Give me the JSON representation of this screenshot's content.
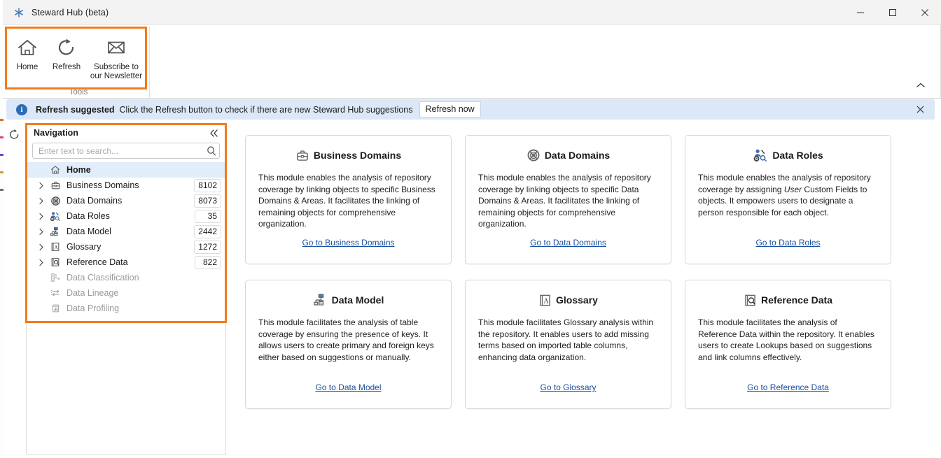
{
  "window": {
    "title": "Steward Hub (beta)",
    "app_icon": "asterisk-icon",
    "minimize_label": "—",
    "maximize_label": "□",
    "close_label": "✕"
  },
  "ribbon": {
    "group_title": "Tools",
    "collapse_label": "˄",
    "buttons": [
      {
        "id": "home",
        "label": "Home",
        "icon": "home-icon"
      },
      {
        "id": "refresh",
        "label": "Refresh",
        "icon": "refresh-icon"
      },
      {
        "id": "subscribe",
        "label": "Subscribe to our Newsletter",
        "icon": "envelope-icon"
      }
    ]
  },
  "notification": {
    "icon": "info-icon",
    "icon_glyph": "i",
    "title": "Refresh suggested",
    "message": "Click the Refresh button to check if there are new Steward Hub suggestions",
    "action_label": "Refresh now",
    "close_label": "✕",
    "background": "#dce8f7",
    "accent": "#2b6cb4"
  },
  "left_strip": {
    "refresh_icon": "refresh-icon"
  },
  "navigation": {
    "title": "Navigation",
    "collapse_label": "«",
    "search": {
      "placeholder": "Enter text to search...",
      "value": "",
      "icon": "search-icon"
    },
    "items": [
      {
        "label": "Home",
        "icon": "home-icon",
        "count": "",
        "expandable": false,
        "selected": true,
        "disabled": false
      },
      {
        "label": "Business Domains",
        "icon": "briefcase-icon",
        "count": "8102",
        "expandable": true,
        "selected": false,
        "disabled": false
      },
      {
        "label": "Data Domains",
        "icon": "globe-grid-icon",
        "count": "8073",
        "expandable": true,
        "selected": false,
        "disabled": false
      },
      {
        "label": "Data Roles",
        "icon": "user-gear-icon",
        "count": "35",
        "expandable": true,
        "selected": false,
        "disabled": false
      },
      {
        "label": "Data Model",
        "icon": "data-model-icon",
        "count": "2442",
        "expandable": true,
        "selected": false,
        "disabled": false
      },
      {
        "label": "Glossary",
        "icon": "glossary-icon",
        "count": "1272",
        "expandable": true,
        "selected": false,
        "disabled": false
      },
      {
        "label": "Reference Data",
        "icon": "reference-data-icon",
        "count": "822",
        "expandable": true,
        "selected": false,
        "disabled": false
      },
      {
        "label": "Data Classification",
        "icon": "classification-icon",
        "count": "",
        "expandable": false,
        "selected": false,
        "disabled": true
      },
      {
        "label": "Data Lineage",
        "icon": "lineage-icon",
        "count": "",
        "expandable": false,
        "selected": false,
        "disabled": true
      },
      {
        "label": "Data Profiling",
        "icon": "profiling-icon",
        "count": "",
        "expandable": false,
        "selected": false,
        "disabled": true
      }
    ]
  },
  "cards": [
    {
      "title": "Business Domains",
      "icon": "briefcase-icon",
      "description": "This module enables the analysis of repository coverage by linking objects to specific Business Domains & Areas. It facilitates the linking of remaining objects for comprehensive organization.",
      "link_label": "Go to Business Domains"
    },
    {
      "title": "Data Domains",
      "icon": "globe-grid-icon",
      "description": "This module enables the analysis of repository coverage by linking objects to specific Data Domains & Areas. It facilitates the linking of remaining objects for comprehensive organization.",
      "link_label": "Go to Data Domains"
    },
    {
      "title": "Data Roles",
      "icon": "user-gear-icon",
      "description_pre": "This module enables the analysis of repository coverage by assigning ",
      "description_em": "User",
      "description_post": " Custom Fields to objects. It empowers users to designate a person responsible for each object.",
      "link_label": "Go to Data Roles"
    },
    {
      "title": "Data Model",
      "icon": "data-model-icon",
      "description": "This module facilitates the analysis of table coverage by ensuring the presence of keys. It allows users to create primary and foreign keys either based on suggestions or manually.",
      "link_label": "Go to Data Model"
    },
    {
      "title": "Glossary",
      "icon": "glossary-icon",
      "description": "This module facilitates Glossary analysis within the repository. It enables users to add missing terms based on imported table columns, enhancing data organization.",
      "link_label": "Go to Glossary"
    },
    {
      "title": "Reference Data",
      "icon": "reference-data-icon",
      "description": "This module facilitates the analysis of Reference Data within the repository. It enables users to create Lookups based on suggestions and link columns effectively.",
      "link_label": "Go to Reference Data"
    }
  ],
  "highlights": {
    "color": "#f07c1e",
    "regions": [
      "tools-group",
      "navigation-panel"
    ]
  }
}
